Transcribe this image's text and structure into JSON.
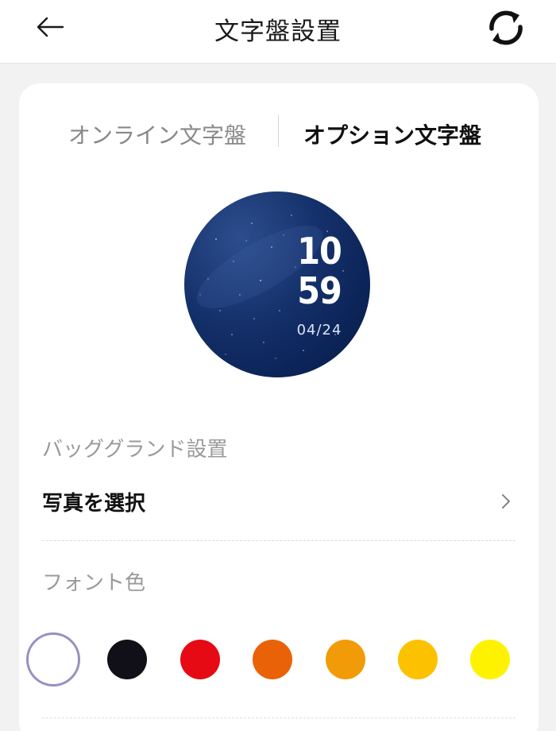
{
  "header": {
    "title": "文字盤設置",
    "back_icon": "arrow-left-icon",
    "sync_icon": "sync-icon"
  },
  "tabs": [
    {
      "label": "オンライン文字盤",
      "active": false
    },
    {
      "label": "オプション文字盤",
      "active": true
    }
  ],
  "preview": {
    "hour": "10",
    "minute": "59",
    "date": "04/24"
  },
  "background_section": {
    "label": "バッググランド設置",
    "select_photo": "写真を選択"
  },
  "font_color_section": {
    "label": "フォント色",
    "colors": [
      {
        "name": "white",
        "hex": "#ffffff",
        "selected": true
      },
      {
        "name": "black",
        "hex": "#111018",
        "selected": false
      },
      {
        "name": "red",
        "hex": "#e60a14",
        "selected": false
      },
      {
        "name": "orange",
        "hex": "#ea6208",
        "selected": false
      },
      {
        "name": "amber",
        "hex": "#f29b08",
        "selected": false
      },
      {
        "name": "gold",
        "hex": "#fcc200",
        "selected": false
      },
      {
        "name": "yellow",
        "hex": "#fff200",
        "selected": false
      }
    ]
  },
  "theme": {
    "selected_ring": "#9a8fbf",
    "watch_bg": "#10296a"
  }
}
